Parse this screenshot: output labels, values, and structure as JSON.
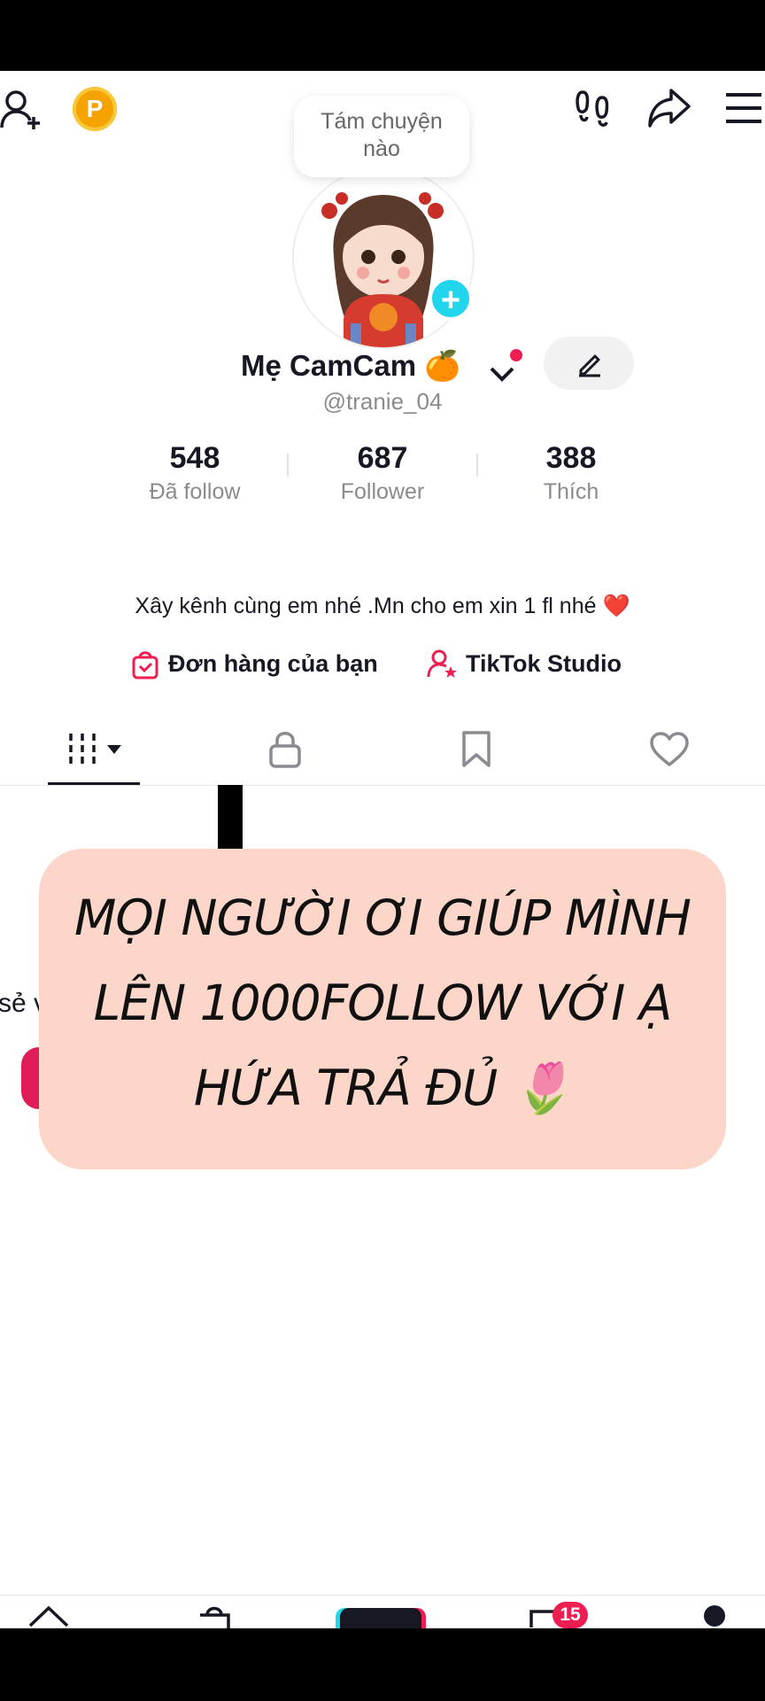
{
  "profile": {
    "bubble_text_line1": "Tám chuyện",
    "bubble_text_line2": "nào",
    "display_name": "Mẹ CamCam 🍊",
    "handle": "@tranie_04",
    "bio": "Xây kênh cùng em nhé .Mn cho em xin 1 fl nhé ❤️"
  },
  "stats": [
    {
      "value": "548",
      "label": "Đã follow"
    },
    {
      "value": "687",
      "label": "Follower"
    },
    {
      "value": "388",
      "label": "Thích"
    }
  ],
  "links": {
    "orders": "Đơn hàng của bạn",
    "studio": "TikTok Studio"
  },
  "coin_label": "P",
  "content": {
    "partial_caption": "sẻ vi"
  },
  "overlay": {
    "line1": "MỌI NGƯỜI ƠI GIÚP MÌNH",
    "line2": "LÊN 1000FOLLOW VỚI Ạ",
    "line3": "HỨA TRẢ ĐỦ 🌷"
  },
  "nav": {
    "inbox_badge": "15"
  },
  "colors": {
    "accent_pink": "#ee1d52",
    "accent_cyan": "#20d5ec",
    "overlay_bg": "#fcd6c8"
  }
}
